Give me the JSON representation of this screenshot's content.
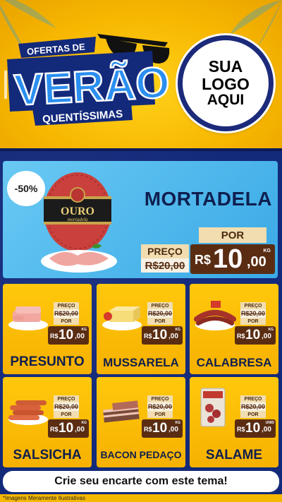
{
  "header": {
    "brand_line1": "OFERTAS DE",
    "brand_main": "VERÃO",
    "brand_line3": "QUENTÍSSIMAS",
    "logo_line1": "SUA",
    "logo_line2": "LOGO",
    "logo_line3": "AQUI"
  },
  "hero": {
    "discount": "-50%",
    "name": "MORTADELA",
    "package_brand": "OURO",
    "package_sub": "mortadela",
    "preco_label": "PREÇO",
    "old_price": "R$20,00",
    "por_label": "POR",
    "currency": "R$",
    "new_int": "10",
    "new_dec": ",00",
    "unit": "KG"
  },
  "products": [
    {
      "name": "PRESUNTO",
      "preco_label": "PREÇO",
      "old_price": "R$20,00",
      "por_label": "POR",
      "currency": "R$",
      "new_int": "10",
      "new_dec": ",00",
      "unit": "KG"
    },
    {
      "name": "MUSSARELA",
      "preco_label": "PREÇO",
      "old_price": "R$20,00",
      "por_label": "POR",
      "currency": "R$",
      "new_int": "10",
      "new_dec": ",00",
      "unit": "KG"
    },
    {
      "name": "CALABRESA",
      "preco_label": "PREÇO",
      "old_price": "R$20,00",
      "por_label": "POR",
      "currency": "R$",
      "new_int": "10",
      "new_dec": ",00",
      "unit": "KG"
    },
    {
      "name": "SALSICHA",
      "preco_label": "PREÇO",
      "old_price": "R$20,00",
      "por_label": "POR",
      "currency": "R$",
      "new_int": "10",
      "new_dec": ",00",
      "unit": "KG"
    },
    {
      "name": "BACON PEDAÇO",
      "preco_label": "PREÇO",
      "old_price": "R$20,00",
      "por_label": "POR",
      "currency": "R$",
      "new_int": "10",
      "new_dec": ",00",
      "unit": "KG"
    },
    {
      "name": "SALAME",
      "preco_label": "PREÇO",
      "old_price": "R$20,00",
      "por_label": "POR",
      "currency": "R$",
      "new_int": "10",
      "new_dec": ",00",
      "unit": "UNID"
    }
  ],
  "cta": "Crie seu encarte com este tema!",
  "footer": "*Imagens Meramente Ilustrativas",
  "colors": {
    "background_yellow": "#f5b800",
    "board_blue": "#13297a",
    "hero_sky": "#3aa9e6",
    "tag_brown": "#5a2d13",
    "tag_cream": "#f1ddb0",
    "name_navy": "#0f1f4f"
  }
}
